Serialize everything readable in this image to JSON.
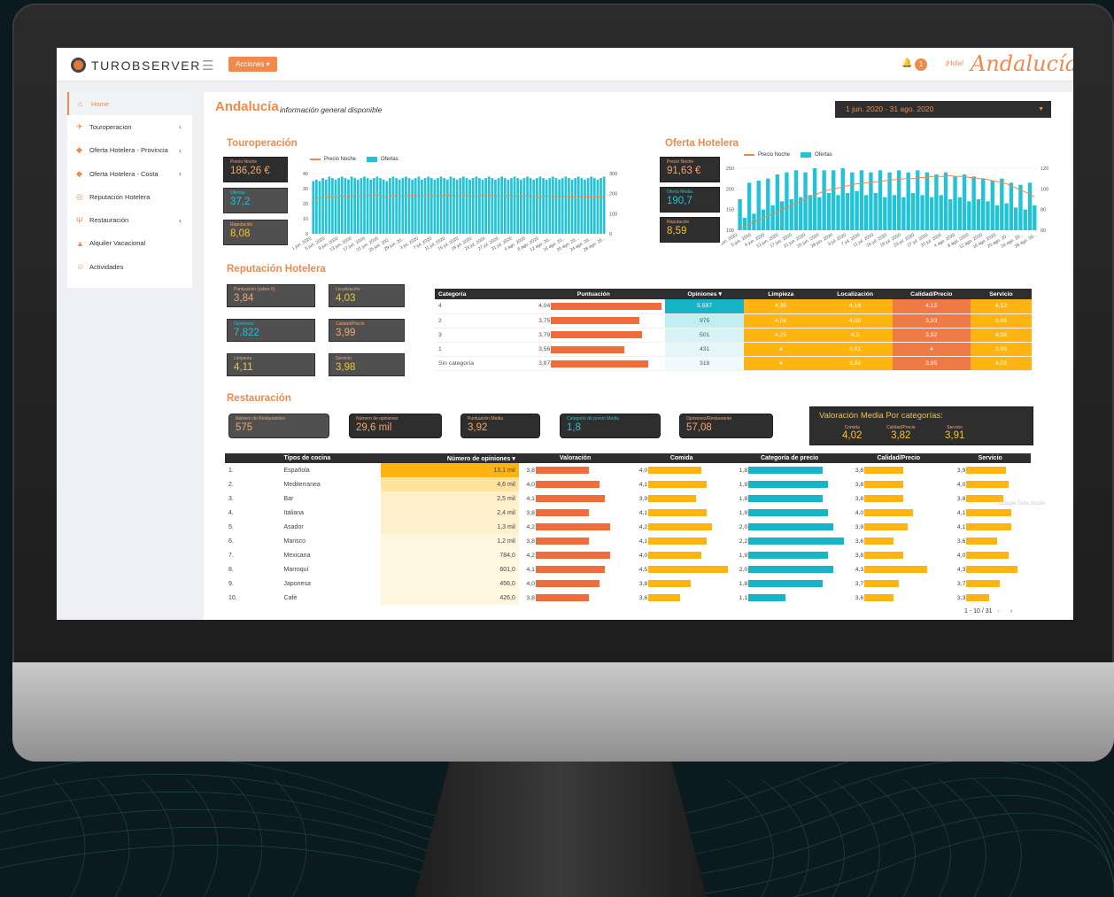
{
  "app": {
    "logo_text": "TUROBSERVER",
    "actions_label": "Acciones ▾",
    "notif_count": "1",
    "greeting": "¡Hola!",
    "brand": "Andalucía"
  },
  "sidebar": {
    "items": [
      {
        "label": "Home",
        "icon": "home-icon"
      },
      {
        "label": "Touroperacion",
        "icon": "plane-icon"
      },
      {
        "label": "Oferta Hotelera - Provincia",
        "icon": "tag-icon"
      },
      {
        "label": "Oferta Hotelera - Costa",
        "icon": "tag-icon"
      },
      {
        "label": "Reputación Hotelera",
        "icon": "review-icon"
      },
      {
        "label": "Restauración",
        "icon": "cutlery-icon"
      },
      {
        "label": "Alquiler Vacacional",
        "icon": "ship-icon"
      },
      {
        "label": "Actividades",
        "icon": "person-icon"
      }
    ]
  },
  "header": {
    "title": "Andalucía",
    "subtitle": "información general disponible",
    "date_range": "1 jun. 2020 - 31 ago. 2020"
  },
  "touroperacion": {
    "title": "Touroperación",
    "kpis": [
      {
        "label": "Precio Noche",
        "value": "186,26 €"
      },
      {
        "label": "Ofertas",
        "value": "37,2"
      },
      {
        "label": "Reputación",
        "value": "8,08"
      }
    ],
    "legend": [
      "Precio Noche",
      "Ofertas"
    ],
    "left_axis": [
      "40",
      "30",
      "20",
      "10",
      "0"
    ],
    "right_axis": [
      "300",
      "200",
      "100",
      "0"
    ],
    "x_labels": [
      "1 jun. 2020",
      "5 jun. 2020",
      "9 jun. 2020",
      "13 jun. 2020",
      "17 jun. 2020",
      "21 jun. 2020",
      "25 jun. 202...",
      "29 jun. 20...",
      "3 jul. 2020",
      "7 jul. 2020",
      "11 jul. 2020",
      "15 jul. 2020",
      "19 jul. 2020",
      "23 jul. 2020",
      "27 jul. 2020",
      "31 jul. 2020",
      "4 ago. 2020",
      "8 ago. 2020",
      "12 ago. 20...",
      "16 ago. 20...",
      "20 ago. 20...",
      "24 ago. 20...",
      "28 ago. 20..."
    ]
  },
  "oferta": {
    "title": "Oferta Hotelera",
    "kpis": [
      {
        "label": "Precio Noche",
        "value": "91,63 €"
      },
      {
        "label": "Oferta Media",
        "value": "190,7"
      },
      {
        "label": "Reputación",
        "value": "8,59"
      }
    ],
    "legend": [
      "Precio Noche",
      "Ofertas"
    ],
    "left_axis": [
      "250",
      "200",
      "150",
      "100"
    ],
    "right_axis": [
      "120",
      "100",
      "80",
      "60"
    ],
    "x_labels": [
      "1 jun. 2020",
      "5 jun. 2020",
      "9 jun. 2020",
      "13 jun. 2020",
      "17 jun. 2020",
      "21 jun. 2020",
      "25 jun. 2020",
      "29 jun. 2020",
      "3 jul. 2020",
      "7 jul. 2020",
      "11 jul. 2020",
      "15 jul. 2020",
      "19 jul. 2020",
      "23 jul. 2020",
      "27 jul. 2020",
      "31 jul. 2020",
      "4 ago. 2020",
      "8 ago. 2020",
      "12 ago. 2020",
      "16 ago. 2020",
      "20 ago. 20...",
      "24 ago. 20...",
      "28 ago. 20..."
    ]
  },
  "chart_data": [
    {
      "type": "bar",
      "title": "Touroperación",
      "series": [
        {
          "name": "Ofertas",
          "values": [
            35,
            36,
            35,
            37,
            36,
            38,
            37,
            36,
            37,
            38,
            37,
            36,
            38,
            37,
            36,
            37,
            38,
            37,
            36,
            37,
            38,
            37,
            36,
            35,
            37,
            38,
            37,
            36,
            37,
            38,
            37,
            36,
            37,
            38,
            36,
            37,
            38,
            37,
            36,
            37,
            38,
            37,
            36,
            38,
            37,
            36,
            37,
            38,
            37,
            36,
            37,
            38,
            37,
            36,
            37,
            38,
            37,
            36,
            37,
            38,
            37,
            36,
            37,
            38,
            37,
            36,
            37,
            38,
            37,
            36,
            37,
            38,
            37,
            36,
            37,
            38,
            37,
            36,
            37,
            38,
            37,
            36,
            37,
            38,
            37,
            36,
            37,
            38,
            37,
            36,
            37,
            38
          ]
        },
        {
          "name": "Precio Noche",
          "values": [
            170,
            175,
            180,
            178,
            182,
            185,
            180,
            184,
            186,
            188,
            185,
            183,
            187,
            190,
            188,
            186,
            189,
            191,
            187,
            190,
            195,
            188,
            186,
            184,
            187,
            192,
            190,
            188,
            186,
            189,
            191,
            193,
            190,
            188,
            186,
            189,
            192,
            190,
            188,
            187,
            189,
            191,
            193,
            190,
            188,
            186,
            189,
            192,
            190,
            188,
            187,
            186,
            189,
            191,
            188,
            190,
            192,
            189,
            187,
            186,
            188,
            191,
            190,
            188,
            186,
            185,
            188,
            190,
            187,
            186,
            185,
            184,
            186,
            188,
            187,
            185,
            184,
            186,
            187,
            185,
            184,
            183,
            185,
            186,
            184,
            183,
            182,
            184,
            185,
            183,
            182,
            184
          ]
        }
      ],
      "ylim": [
        0,
        40
      ],
      "y2lim": [
        0,
        300
      ]
    },
    {
      "type": "bar",
      "title": "Oferta Hotelera",
      "series": [
        {
          "name": "Ofertas",
          "values": [
            175,
            130,
            215,
            140,
            220,
            150,
            225,
            160,
            235,
            170,
            240,
            175,
            245,
            180,
            240,
            185,
            250,
            180,
            245,
            190,
            245,
            185,
            250,
            190,
            240,
            195,
            245,
            185,
            240,
            190,
            245,
            180,
            240,
            185,
            245,
            180,
            240,
            190,
            245,
            185,
            240,
            180,
            235,
            185,
            240,
            175,
            230,
            180,
            235,
            170,
            230,
            175,
            225,
            170,
            220,
            160,
            225,
            165,
            215,
            155,
            210,
            150,
            215,
            160
          ]
        },
        {
          "name": "Precio Noche",
          "values": [
            62,
            64,
            66,
            68,
            70,
            72,
            74,
            76,
            78,
            80,
            82,
            84,
            86,
            88,
            90,
            92,
            94,
            96,
            98,
            99,
            100,
            101,
            102,
            103,
            104,
            105,
            105,
            106,
            106,
            107,
            107,
            108,
            108,
            109,
            109,
            110,
            110,
            110,
            111,
            111,
            111,
            112,
            112,
            112,
            112,
            113,
            112,
            112,
            112,
            111,
            111,
            110,
            110,
            109,
            108,
            107,
            106,
            105,
            103,
            101,
            99,
            97,
            95,
            92
          ]
        }
      ],
      "ylim": [
        100,
        250
      ],
      "y2lim": [
        60,
        120
      ]
    }
  ],
  "reputacion": {
    "title": "Reputación Hotelera",
    "kpis": [
      {
        "label": "Puntuación (sobre 5)",
        "value": "3,84"
      },
      {
        "label": "Localización",
        "value": "4,03"
      },
      {
        "label": "Opiniones",
        "value": "7.822"
      },
      {
        "label": "Calidad/Precio",
        "value": "3,99"
      },
      {
        "label": "Limpieza",
        "value": "4,11"
      },
      {
        "label": "Servicio",
        "value": "3,98"
      }
    ],
    "table": {
      "headers": [
        "Categoría",
        "Puntuación",
        "Opiniones ▾",
        "Limpieza",
        "Localización",
        "Calidad/Precio",
        "Servicio"
      ],
      "rows": [
        {
          "cat": "4",
          "punt": "4,04",
          "punt_v": 4.04,
          "op": "5.597",
          "limp": "4,35",
          "loc": "4,19",
          "cp": "4,12",
          "serv": "4,12"
        },
        {
          "cat": "2",
          "punt": "3,75",
          "punt_v": 3.75,
          "op": "975",
          "limp": "4,06",
          "loc": "4,06",
          "cp": "3,93",
          "serv": "3,86"
        },
        {
          "cat": "3",
          "punt": "3,79",
          "punt_v": 3.79,
          "op": "501",
          "limp": "4,25",
          "loc": "4,5",
          "cp": "3,92",
          "serv": "4,08"
        },
        {
          "cat": "1",
          "punt": "3,56",
          "punt_v": 3.56,
          "op": "431",
          "limp": "4",
          "loc": "3,81",
          "cp": "4",
          "serv": "3,69"
        },
        {
          "cat": "Sin categoría",
          "punt": "3,87",
          "punt_v": 3.87,
          "op": "318",
          "limp": "4",
          "loc": "3,86",
          "cp": "3,95",
          "serv": "4,03"
        }
      ]
    }
  },
  "restauracion": {
    "title": "Restauración",
    "kpis": [
      {
        "label": "Número de Restaurantes",
        "value": "575"
      },
      {
        "label": "Número de opiniones",
        "value": "29,6 mil"
      },
      {
        "label": "Puntuación Media",
        "value": "3,92"
      },
      {
        "label": "Categoría de precio Media",
        "value": "1,8"
      },
      {
        "label": "Opiniones/Restaurante",
        "value": "57,08"
      }
    ],
    "valoracion": {
      "title": "Valoración Media Por categorías:",
      "items": [
        {
          "label": "Comida",
          "value": "4,02"
        },
        {
          "label": "Calidad/Precio",
          "value": "3,82"
        },
        {
          "label": "Servicio",
          "value": "3,91"
        }
      ]
    },
    "table": {
      "headers": [
        "",
        "Tipos de cocina",
        "Número de opiniones ▾",
        "Valoración",
        "Comida",
        "Categoría de precio",
        "Calidad/Precio",
        "Servicio"
      ],
      "rows": [
        {
          "n": "1.",
          "tipo": "Española",
          "op": "13,1 mil",
          "op_v": 13100,
          "val": "3,8",
          "val_v": 3.8,
          "com": "4,0",
          "com_v": 4.0,
          "cat": "1,8",
          "cat_v": 1.8,
          "cp": "3,8",
          "cp_v": 3.8,
          "serv": "3,9",
          "serv_v": 3.9
        },
        {
          "n": "2.",
          "tipo": "Mediterranea",
          "op": "4,6 mil",
          "op_v": 4600,
          "val": "4,0",
          "val_v": 4.0,
          "com": "4,1",
          "com_v": 4.1,
          "cat": "1,9",
          "cat_v": 1.9,
          "cp": "3,8",
          "cp_v": 3.8,
          "serv": "4,0",
          "serv_v": 4.0
        },
        {
          "n": "3.",
          "tipo": "Bar",
          "op": "2,5 mil",
          "op_v": 2500,
          "val": "4,1",
          "val_v": 4.1,
          "com": "3,9",
          "com_v": 3.9,
          "cat": "1,8",
          "cat_v": 1.8,
          "cp": "3,8",
          "cp_v": 3.8,
          "serv": "3,8",
          "serv_v": 3.8
        },
        {
          "n": "4.",
          "tipo": "Italiana",
          "op": "2,4 mil",
          "op_v": 2400,
          "val": "3,8",
          "val_v": 3.8,
          "com": "4,1",
          "com_v": 4.1,
          "cat": "1,9",
          "cat_v": 1.9,
          "cp": "4,0",
          "cp_v": 4.0,
          "serv": "4,1",
          "serv_v": 4.1
        },
        {
          "n": "5.",
          "tipo": "Asador",
          "op": "1,3 mil",
          "op_v": 1300,
          "val": "4,2",
          "val_v": 4.2,
          "com": "4,2",
          "com_v": 4.2,
          "cat": "2,0",
          "cat_v": 2.0,
          "cp": "3,9",
          "cp_v": 3.9,
          "serv": "4,1",
          "serv_v": 4.1
        },
        {
          "n": "6.",
          "tipo": "Marisco",
          "op": "1,2 mil",
          "op_v": 1200,
          "val": "3,8",
          "val_v": 3.8,
          "com": "4,1",
          "com_v": 4.1,
          "cat": "2,2",
          "cat_v": 2.2,
          "cp": "3,6",
          "cp_v": 3.6,
          "serv": "3,6",
          "serv_v": 3.6
        },
        {
          "n": "7.",
          "tipo": "Mexicana",
          "op": "784,0",
          "op_v": 784,
          "val": "4,2",
          "val_v": 4.2,
          "com": "4,0",
          "com_v": 4.0,
          "cat": "1,9",
          "cat_v": 1.9,
          "cp": "3,8",
          "cp_v": 3.8,
          "serv": "4,0",
          "serv_v": 4.0
        },
        {
          "n": "8.",
          "tipo": "Marroquí",
          "op": "601,0",
          "op_v": 601,
          "val": "4,1",
          "val_v": 4.1,
          "com": "4,5",
          "com_v": 4.5,
          "cat": "2,0",
          "cat_v": 2.0,
          "cp": "4,3",
          "cp_v": 4.3,
          "serv": "4,3",
          "serv_v": 4.3
        },
        {
          "n": "9.",
          "tipo": "Japonesa",
          "op": "456,0",
          "op_v": 456,
          "val": "4,0",
          "val_v": 4.0,
          "com": "3,8",
          "com_v": 3.8,
          "cat": "1,8",
          "cat_v": 1.8,
          "cp": "3,7",
          "cp_v": 3.7,
          "serv": "3,7",
          "serv_v": 3.7
        },
        {
          "n": "10.",
          "tipo": "Café",
          "op": "426,0",
          "op_v": 426,
          "val": "3,8",
          "val_v": 3.8,
          "com": "3,6",
          "com_v": 3.6,
          "cat": "1,1",
          "cat_v": 1.1,
          "cp": "3,6",
          "cp_v": 3.6,
          "serv": "3,3",
          "serv_v": 3.3
        }
      ]
    },
    "pager": "1 - 10 / 31",
    "footer_mark": "Google Data Studio"
  },
  "colors": {
    "accent": "#f08a4b",
    "cyan": "#22c3d6",
    "yellow": "#f7c332",
    "dark": "#2e2e2e"
  }
}
